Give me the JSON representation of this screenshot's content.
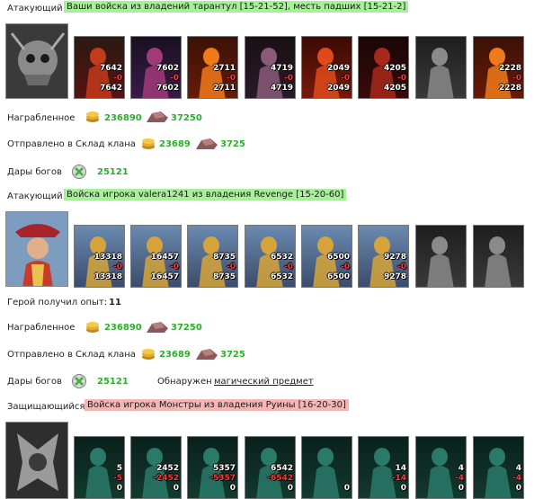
{
  "battle1": {
    "role": "Атакующий",
    "banner": "Ваши войска из владений тарантул [15-21-52], месть падших [15-21-2]",
    "units": [
      {
        "n1": "7642",
        "n2": "-0",
        "n3": "7642",
        "palette": "red"
      },
      {
        "n1": "7602",
        "n2": "-0",
        "n3": "7602",
        "palette": "purple"
      },
      {
        "n1": "2711",
        "n2": "-0",
        "n3": "2711",
        "palette": "fire"
      },
      {
        "n1": "4719",
        "n2": "-0",
        "n3": "4719",
        "palette": "dragon"
      },
      {
        "n1": "2049",
        "n2": "-0",
        "n3": "2049",
        "palette": "lava"
      },
      {
        "n1": "4205",
        "n2": "-0",
        "n3": "4205",
        "palette": "dark-red"
      },
      {
        "n1": "",
        "n2": "",
        "n3": "",
        "palette": "grey"
      },
      {
        "n1": "2228",
        "n2": "-0",
        "n3": "2228",
        "palette": "fire"
      }
    ],
    "looted_label": "Награбленное",
    "looted_gold": "236890",
    "looted_ore": "37250",
    "sent_label": "Отправлено в Склад клана",
    "sent_gold": "23689",
    "sent_ore": "3725",
    "gifts_label": "Дары богов",
    "gifts_value": "25121"
  },
  "battle2": {
    "role": "Атакующий",
    "banner": "Войска игрока valera1241 из владения Revenge [15-20-60]",
    "units": [
      {
        "n1": "13318",
        "n2": "-0",
        "n3": "13318",
        "palette": "gold"
      },
      {
        "n1": "16457",
        "n2": "-0",
        "n3": "16457",
        "palette": "gold"
      },
      {
        "n1": "8735",
        "n2": "-0",
        "n3": "8735",
        "palette": "gold"
      },
      {
        "n1": "6532",
        "n2": "-0",
        "n3": "6532",
        "palette": "gold"
      },
      {
        "n1": "6500",
        "n2": "-0",
        "n3": "6500",
        "palette": "gold"
      },
      {
        "n1": "9278",
        "n2": "-0",
        "n3": "9278",
        "palette": "gold"
      },
      {
        "n1": "",
        "n2": "",
        "n3": "",
        "palette": "grey"
      },
      {
        "n1": "",
        "n2": "",
        "n3": "",
        "palette": "grey"
      }
    ],
    "xp_label": "Герой получил опыт:",
    "xp_value": "11",
    "looted_label": "Награбленное",
    "looted_gold": "236890",
    "looted_ore": "37250",
    "sent_label": "Отправлено в Склад клана",
    "sent_gold": "23689",
    "sent_ore": "3725",
    "gifts_label": "Дары богов",
    "gifts_value": "25121",
    "found_label": "Обнаружен",
    "found_link": "магический предмет"
  },
  "battle3": {
    "role": "Защищающийся",
    "banner": "Войска игрока Монстры из владения Руины [16-20-30]",
    "units": [
      {
        "n1": "5",
        "n2": "-5",
        "n3": "0",
        "palette": "teal"
      },
      {
        "n1": "2452",
        "n2": "-2452",
        "n3": "0",
        "palette": "teal"
      },
      {
        "n1": "5357",
        "n2": "-5357",
        "n3": "0",
        "palette": "teal"
      },
      {
        "n1": "6542",
        "n2": "-6542",
        "n3": "0",
        "palette": "teal"
      },
      {
        "n1": "",
        "n2": "",
        "n3": "0",
        "palette": "teal"
      },
      {
        "n1": "14",
        "n2": "-14",
        "n3": "0",
        "palette": "teal"
      },
      {
        "n1": "4",
        "n2": "-4",
        "n3": "0",
        "palette": "teal"
      },
      {
        "n1": "4",
        "n2": "-4",
        "n3": "0",
        "palette": "teal"
      }
    ]
  }
}
